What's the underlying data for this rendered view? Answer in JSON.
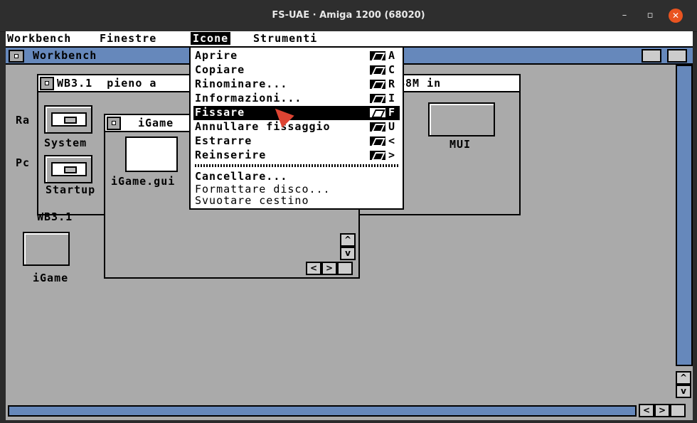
{
  "host": {
    "title": "FS-UAE · Amiga 1200 (68020)",
    "minimize": "–",
    "maximize": "▫",
    "close": "✕"
  },
  "menubar": {
    "items": [
      "Workbench",
      "Finestre",
      "Icone",
      "Strumenti"
    ],
    "active": "Icone"
  },
  "workbench_window": {
    "title": "Workbench"
  },
  "wb31_window": {
    "title": "WB3.1  pieno a",
    "title_tail": "48M in",
    "icons": [
      "System",
      "Startup"
    ],
    "partial_labels": [
      "Ra",
      "Pc"
    ],
    "label": "WB3.1"
  },
  "igame_window": {
    "title": "iGame",
    "icons": [
      "iGame.gui"
    ]
  },
  "desktop_icons": [
    "iGame",
    "MUI"
  ],
  "menu": {
    "items": [
      {
        "label": "Aprire",
        "key": "A"
      },
      {
        "label": "Copiare",
        "key": "C"
      },
      {
        "label": "Rinominare...",
        "key": "R"
      },
      {
        "label": "Informazioni...",
        "key": "I"
      },
      {
        "label": "Fissare",
        "key": "F",
        "highlighted": true
      },
      {
        "label": "Annullare fissaggio",
        "key": "U"
      },
      {
        "label": "Estrarre",
        "key": "<"
      },
      {
        "label": "Reinserire",
        "key": ">"
      }
    ],
    "items2": [
      {
        "label": "Cancellare...",
        "enabled": true
      },
      {
        "label": "Formattare disco...",
        "enabled": false
      },
      {
        "label": "Svuotare cestino",
        "enabled": false
      }
    ]
  },
  "colors": {
    "screen_bg": "#aaaaaa",
    "title_blue": "#6688bb",
    "pointer_red": "#dd4433",
    "host_close": "#e95420"
  },
  "scroll": {
    "up": "^",
    "down": "v",
    "left": "<",
    "right": ">"
  }
}
